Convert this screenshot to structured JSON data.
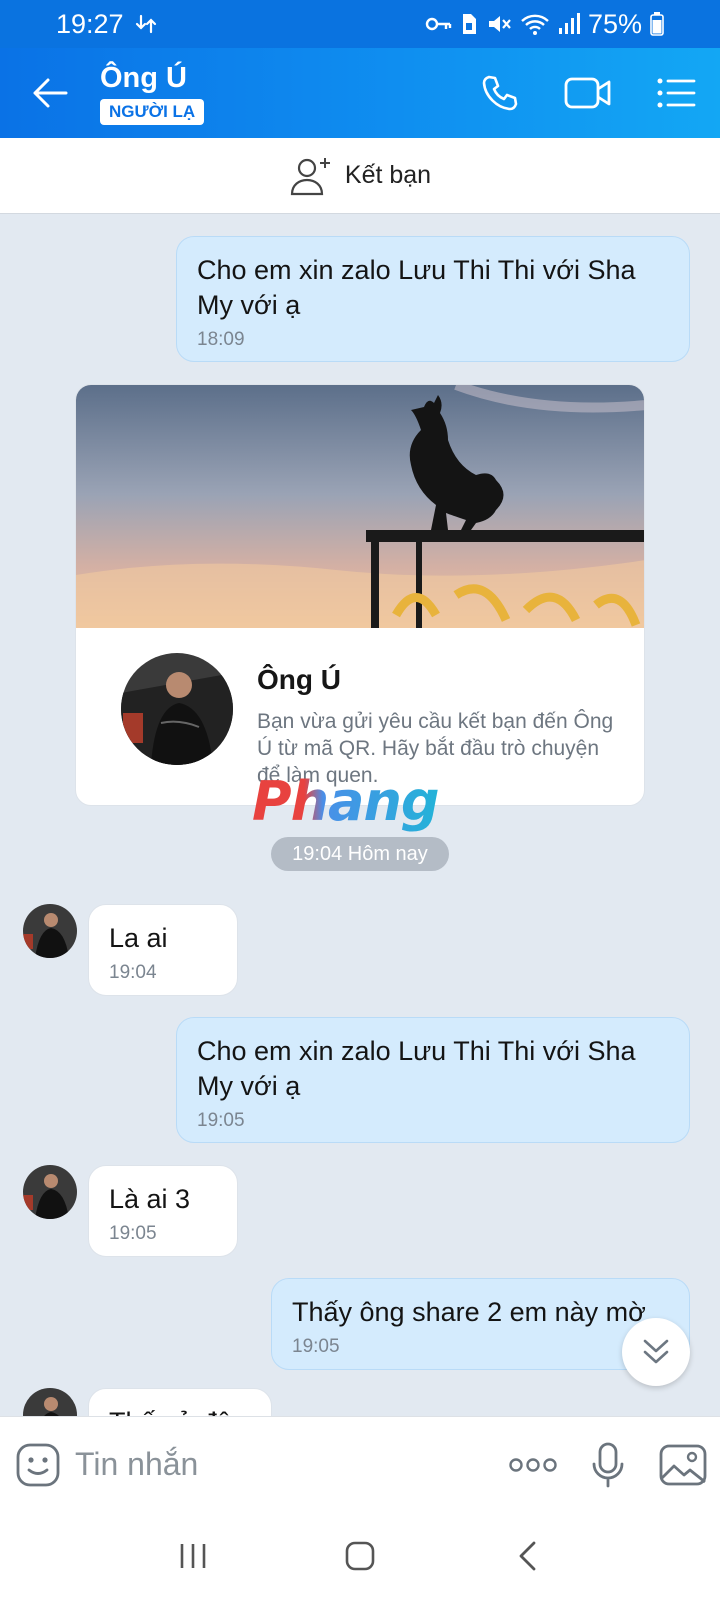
{
  "status_bar": {
    "time": "19:27",
    "battery": "75%"
  },
  "header": {
    "title": "Ông Ú",
    "badge": "NGƯỜI LẠ"
  },
  "add_friend": {
    "label": "Kết bạn"
  },
  "messages": [
    {
      "side": "me",
      "text": "Cho em xin zalo Lưu Thi Thi với Sha My với ạ",
      "time": "18:09"
    },
    {
      "side": "them",
      "text": "La ai",
      "time": "19:04"
    },
    {
      "side": "me",
      "text": "Cho em xin zalo Lưu Thi Thi với Sha My với ạ",
      "time": "19:05"
    },
    {
      "side": "them",
      "text": "Là ai 3",
      "time": "19:05"
    },
    {
      "side": "me",
      "text": "Thấy ông share 2 em này mờ",
      "time": "19:05"
    },
    {
      "side": "them",
      "text": "Thấy ở đâu",
      "time": ""
    }
  ],
  "profile_card": {
    "name": "Ông Ú",
    "description": "Bạn vừa gửi yêu cầu kết bạn đến Ông Ú từ mã QR. Hãy bắt đầu trò chuyện để làm quen."
  },
  "date_separator": "19:04 Hôm nay",
  "watermark": "Phang",
  "composer": {
    "placeholder": "Tin nhắn"
  },
  "colors": {
    "header_blue": "#0a72e6",
    "my_bubble": "#d4ebfd",
    "chat_bg": "#e2e9f1"
  }
}
